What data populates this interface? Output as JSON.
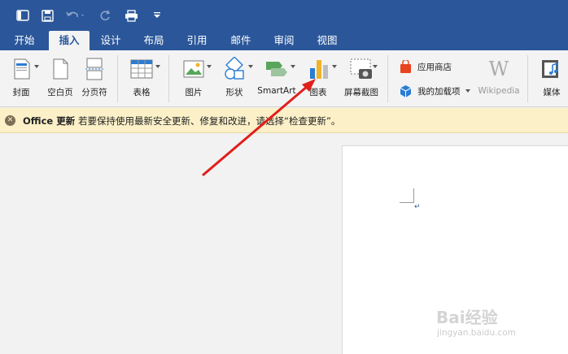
{
  "tabs": [
    "开始",
    "插入",
    "设计",
    "布局",
    "引用",
    "邮件",
    "审阅",
    "视图"
  ],
  "active_tab": "插入",
  "ribbon": {
    "cover": "封面",
    "blank_page": "空白页",
    "page_break": "分页符",
    "table": "表格",
    "picture": "图片",
    "shapes": "形状",
    "smartart": "SmartArt",
    "chart": "图表",
    "screenshot": "屏幕截图",
    "app_store": "应用商店",
    "my_addins": "我的加载项",
    "wikipedia": "Wikipedia",
    "media": "媒体"
  },
  "notification": {
    "title": "Office 更新",
    "message": "若要保持使用最新安全更新、修复和改进，请选择“检查更新”。"
  },
  "watermark": {
    "brand": "Bai经验",
    "url": "jingyan.baidu.com"
  },
  "colors": {
    "titlebar": "#2b579a",
    "ribbon": "#f3f3f3",
    "notify": "#fbf0c8",
    "arrow": "#e0201c"
  }
}
